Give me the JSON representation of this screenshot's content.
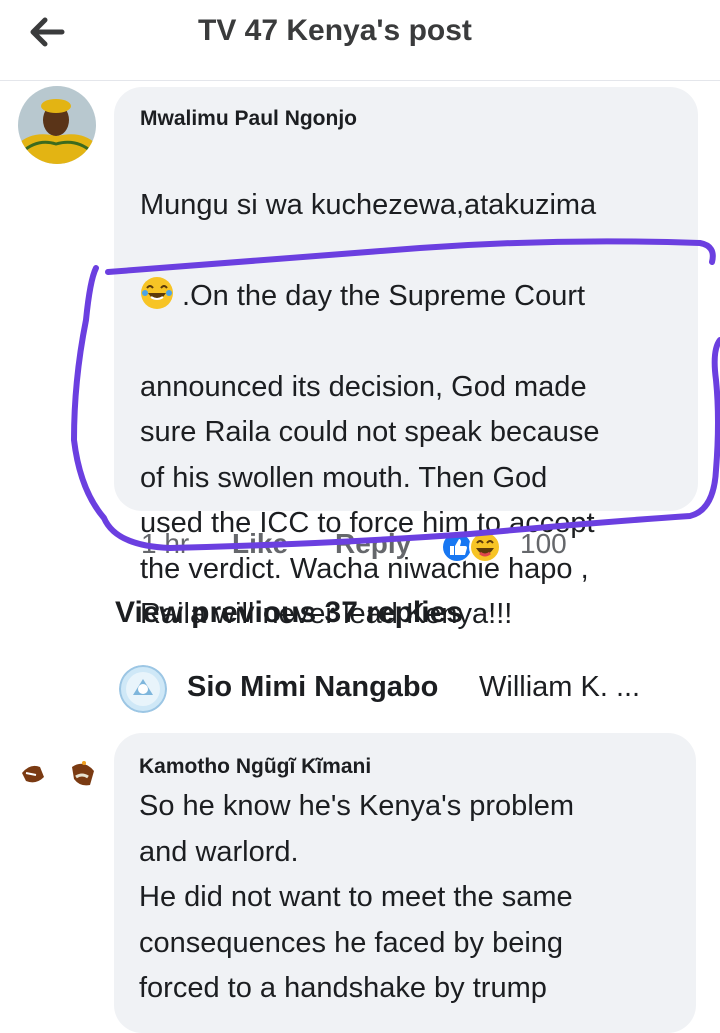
{
  "header": {
    "title": "TV 47 Kenya's post",
    "back_icon": "arrow-left-icon"
  },
  "comment1": {
    "author": "Mwalimu Paul Ngonjo",
    "text_before_emoji": "Mungu si wa kuchezewa,atakuzima",
    "emoji": "laughing-tears-emoji",
    "text_after_emoji": " .On the day the Supreme Court",
    "text_rest": "announced its decision, God made\nsure Raila could not speak because\nof his swollen mouth. Then God\nused the ICC to force him to accept\nthe verdict. Wacha niwachie hapo ,\nRaila will never lead Kenya!!!",
    "time": "1 hr",
    "like_label": "Like",
    "reply_label": "Reply",
    "reaction_count": "100",
    "reaction_icons": [
      "like-reaction-icon",
      "haha-reaction-icon"
    ]
  },
  "view_previous": "View previous 37 replies",
  "reply_preview": {
    "name": "Sio Mimi Nangabo",
    "preview": "William K. ..."
  },
  "comment2": {
    "author": "Kamotho Ngũgĩ Kĩmani",
    "text": "So he know he's Kenya's problem\nand warlord.\nHe did not want to meet the same\nconsequences he faced by being\nforced to a handshake by trump"
  },
  "colors": {
    "annotation": "#6b3fe0",
    "bubble": "#f0f2f5",
    "meta": "#65676b"
  }
}
